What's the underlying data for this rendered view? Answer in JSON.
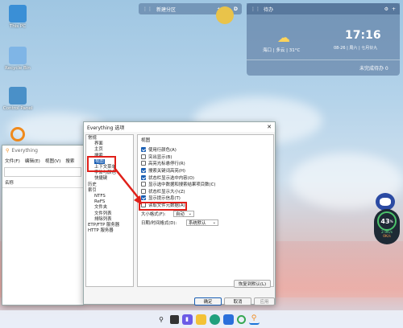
{
  "desktop": {
    "icons": [
      {
        "label": "This PC",
        "color": "#3a8fd6"
      },
      {
        "label": "Recycle Bin",
        "color": "#7fb5e6"
      },
      {
        "label": "Control Panel",
        "color": "#4a90c8"
      },
      {
        "label": "",
        "color": "#f08a1c"
      }
    ]
  },
  "top_widget": {
    "label": "新建分区",
    "plus": "+",
    "tag": "D"
  },
  "weather_widget": {
    "header": "待办",
    "time": "17:16",
    "date": "08-26 | 周六 | 七月廿九",
    "location": "海口 | 多云 | 31°C",
    "todo": "未完成待办 0"
  },
  "everything_bg": {
    "title": "Everything",
    "menu": [
      "文件(F)",
      "编辑(E)",
      "视图(V)",
      "搜索"
    ],
    "col_name": "名称"
  },
  "dialog": {
    "title": "Everything 选项",
    "tree": [
      {
        "text": "常规",
        "indent": 0
      },
      {
        "text": "界面",
        "indent": 1
      },
      {
        "text": "主页",
        "indent": 1
      },
      {
        "text": "搜索",
        "indent": 1
      },
      {
        "text": "视图",
        "indent": 1,
        "selected": true
      },
      {
        "text": "上下文菜单",
        "indent": 1
      },
      {
        "text": "字体与颜色",
        "indent": 1
      },
      {
        "text": "快捷键",
        "indent": 1
      },
      {
        "text": "历史",
        "indent": 0
      },
      {
        "text": "索引",
        "indent": 0
      },
      {
        "text": "NTFS",
        "indent": 1
      },
      {
        "text": "ReFS",
        "indent": 1
      },
      {
        "text": "文件夹",
        "indent": 1
      },
      {
        "text": "文件列表",
        "indent": 1
      },
      {
        "text": "排除列表",
        "indent": 1
      },
      {
        "text": "ETP/FTP 服务器",
        "indent": 0
      },
      {
        "text": "HTTP 服务器",
        "indent": 0
      }
    ],
    "section": "视图",
    "options": [
      {
        "text": "使用行颜色(A)",
        "checked": true
      },
      {
        "text": "突出显示(B)",
        "checked": false
      },
      {
        "text": "高亮光标悬停行(R)",
        "checked": false
      },
      {
        "text": "搜索关键词高亮(H)",
        "checked": true
      },
      {
        "text": "状态栏显示选中内容(O)",
        "checked": true
      },
      {
        "text": "显示选中数据和搜索结果项目数(C)",
        "checked": false
      },
      {
        "text": "状态栏显示大小(Z)",
        "checked": false
      },
      {
        "text": "显示提示信息(T)",
        "checked": true
      },
      {
        "text": "读取文件元数据(A)",
        "checked": false
      }
    ],
    "size_label": "大小格式(F):",
    "size_value": "自动",
    "date_label": "日期/时间格式(D):",
    "date_value": "系统默认",
    "restore": "恢复到默认(L)",
    "ok": "确定",
    "cancel": "取消",
    "apply": "应用"
  },
  "side_widget": {
    "value": "43",
    "unit": "%",
    "up": "2.9K/s",
    "down": "0K/s"
  },
  "taskbar": {
    "icons": [
      "start-icon",
      "search-icon",
      "widgets-icon",
      "chat-icon",
      "explorer-icon",
      "edge-icon",
      "store-icon",
      "browser-icon",
      "everything-icon"
    ]
  }
}
